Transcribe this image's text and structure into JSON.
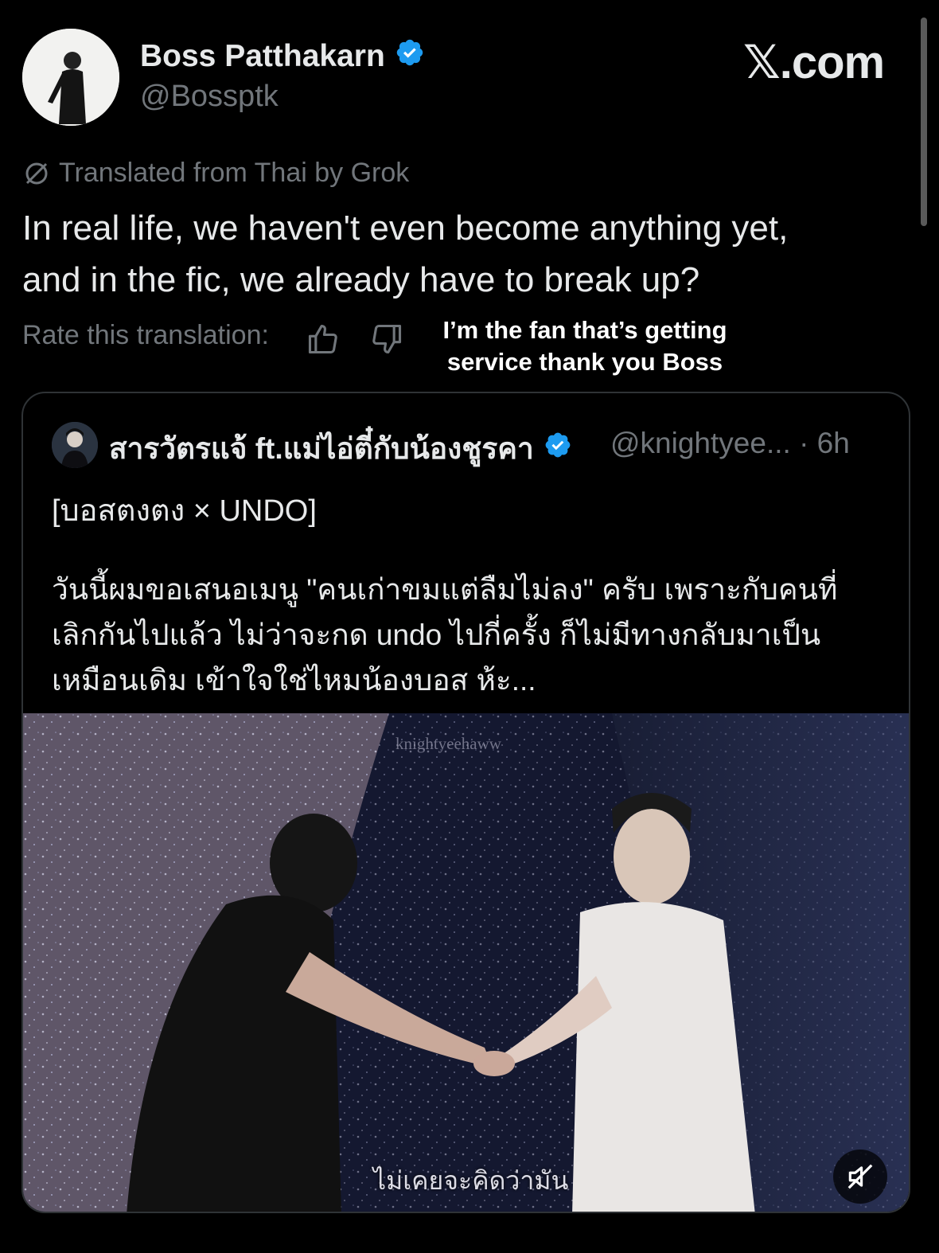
{
  "header": {
    "display_name": "Boss Patthakarn",
    "handle": "@Bossptk",
    "brand": "𝕏.com"
  },
  "translation": {
    "note": "Translated from Thai by Grok",
    "text_line1": "In real life, we haven't even become anything yet,",
    "text_line2": "and in the fic, we already have to break up?",
    "rate_label": "Rate this translation:"
  },
  "overlay_caption": {
    "line1": "I’m the fan that’s getting",
    "line2": "service thank you Boss"
  },
  "quoted": {
    "display_name": "สารวัตรแจ้ ft.แม่ไอ่ตี๋กับน้องชูรคา",
    "handle_time": "@knightyee... · 6h",
    "title": "[บอสตงตง × UNDO]",
    "body_line1": "วันนี้ผมขอเสนอเมนู \"คนเก่าขมแต่ลืมไม่ลง\" ครับ เพราะกับคนที่",
    "body_line2": "เลิกกันไปแล้ว ไม่ว่าจะกด undo ไปกี่ครั้ง ก็ไม่มีทางกลับมาเป็น",
    "body_line3": "เหมือนเดิม เข้าใจใช่ไหมน้องบอส ห้ะ...",
    "media": {
      "watermark": "knightyeehaww",
      "subtitle": "ไม่เคยจะคิดว่ามัน"
    }
  },
  "colors": {
    "background": "#000000",
    "text_primary": "#e7e9ea",
    "text_secondary": "#71767b",
    "verified_blue": "#1d9bf0",
    "border": "#2f3336"
  },
  "icons": [
    "verified-badge-icon",
    "grok-slash-icon",
    "thumbs-up-icon",
    "thumbs-down-icon",
    "muted-speaker-icon"
  ]
}
